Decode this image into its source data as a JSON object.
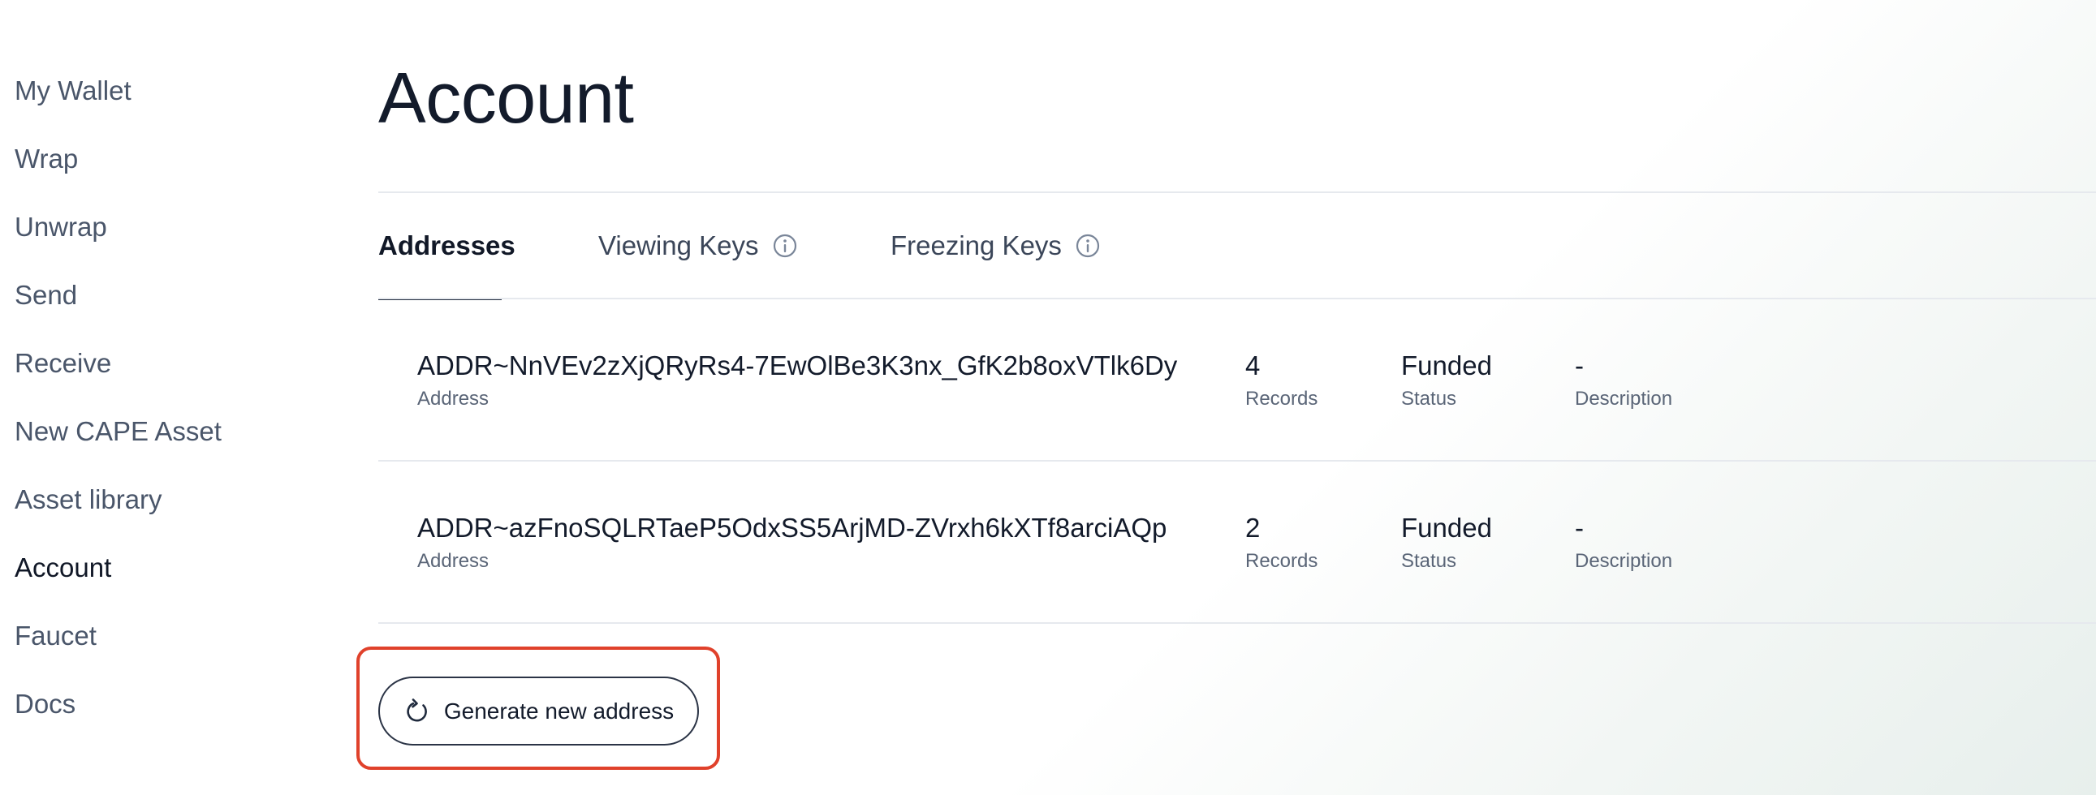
{
  "sidebar": {
    "items": [
      {
        "label": "My Wallet"
      },
      {
        "label": "Wrap"
      },
      {
        "label": "Unwrap"
      },
      {
        "label": "Send"
      },
      {
        "label": "Receive"
      },
      {
        "label": "New CAPE Asset"
      },
      {
        "label": "Asset library"
      },
      {
        "label": "Account",
        "active": true
      },
      {
        "label": "Faucet"
      },
      {
        "label": "Docs"
      }
    ]
  },
  "page": {
    "title": "Account"
  },
  "tabs": [
    {
      "label": "Addresses",
      "active": true
    },
    {
      "label": "Viewing Keys",
      "icon": "info-icon"
    },
    {
      "label": "Freezing Keys",
      "icon": "info-icon"
    }
  ],
  "columns": {
    "address": "Address",
    "records": "Records",
    "status": "Status",
    "description": "Description"
  },
  "rows": [
    {
      "address": "ADDR~NnVEv2zXjQRyRs4-7EwOlBe3K3nx_GfK2b8oxVTlk6Dy",
      "records": "4",
      "status": "Funded",
      "description": "-"
    },
    {
      "address": "ADDR~azFnoSQLRTaeP5OdxSS5ArjMD-ZVrxh6kXTf8arciAQp",
      "records": "2",
      "status": "Funded",
      "description": "-"
    }
  ],
  "actions": {
    "generate_label": "Generate new address",
    "generate_icon": "refresh-icon"
  },
  "colors": {
    "highlight": "#e0412b",
    "text_primary": "#131b2b",
    "text_secondary": "#5a6577"
  }
}
